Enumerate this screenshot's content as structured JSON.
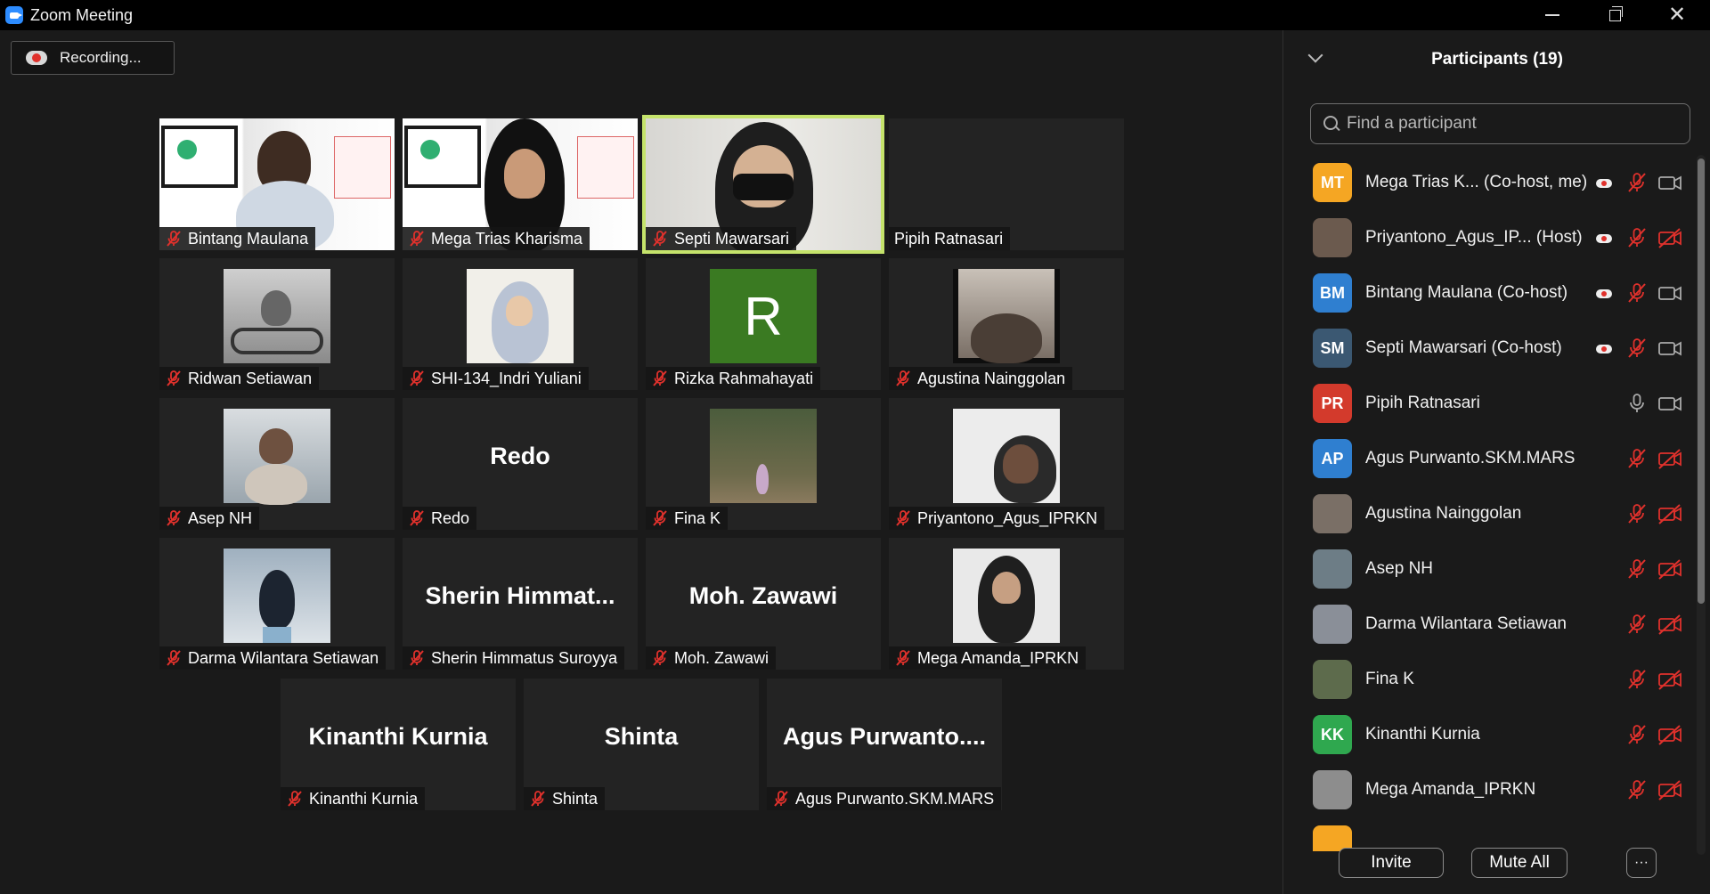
{
  "window": {
    "title": "Zoom Meeting"
  },
  "recording": {
    "label": "Recording..."
  },
  "tiles": [
    {
      "name": "Bintang Maulana",
      "kind": "video",
      "active": false
    },
    {
      "name": "Mega Trias Kharisma",
      "kind": "video",
      "active": false
    },
    {
      "name": "Septi Mawarsari",
      "kind": "video",
      "active": true
    },
    {
      "name": "Pipih Ratnasari",
      "kind": "blank",
      "active": false
    },
    {
      "name": "Ridwan Setiawan",
      "kind": "photo",
      "active": false
    },
    {
      "name": "SHI-134_Indri Yuliani",
      "kind": "photo",
      "active": false
    },
    {
      "name": "Rizka Rahmahayati",
      "kind": "initial",
      "initial": "R",
      "active": false
    },
    {
      "name": "Agustina Nainggolan",
      "kind": "photo",
      "active": false
    },
    {
      "name": "Asep NH",
      "kind": "photo",
      "active": false
    },
    {
      "name": "Redo",
      "kind": "text",
      "display": "Redo",
      "active": false
    },
    {
      "name": "Fina K",
      "kind": "photo",
      "active": false
    },
    {
      "name": "Priyantono_Agus_IPRKN",
      "kind": "photo",
      "active": false
    },
    {
      "name": "Darma Wilantara Setiawan",
      "kind": "photo",
      "active": false
    },
    {
      "name": "Sherin Himmatus Suroyya",
      "kind": "text",
      "display": "Sherin  Himmat...",
      "active": false
    },
    {
      "name": "Moh. Zawawi",
      "kind": "text",
      "display": "Moh. Zawawi",
      "active": false
    },
    {
      "name": "Mega Amanda_IPRKN",
      "kind": "photo",
      "active": false
    },
    {
      "name": "Kinanthi Kurnia",
      "kind": "text",
      "display": "Kinanthi Kurnia",
      "active": false
    },
    {
      "name": "Shinta",
      "kind": "text",
      "display": "Shinta",
      "active": false
    },
    {
      "name": "Agus Purwanto.SKM.MARS",
      "kind": "text",
      "display": "Agus  Purwanto....",
      "active": false
    }
  ],
  "panel": {
    "title": "Participants (19)",
    "search_placeholder": "Find a participant",
    "participants": [
      {
        "initials": "MT",
        "color": "#f5a623",
        "name": "Mega Trias K...  (Co-host, me)",
        "recording": true,
        "mic": "muted",
        "cam": "on"
      },
      {
        "initials": "",
        "color": "#6b5a4e",
        "name": "Priyantono_Agus_IP...  (Host)",
        "recording": true,
        "mic": "muted",
        "cam": "off"
      },
      {
        "initials": "BM",
        "color": "#2f7fd0",
        "name": "Bintang Maulana (Co-host)",
        "recording": true,
        "mic": "muted",
        "cam": "on"
      },
      {
        "initials": "SM",
        "color": "#3b5872",
        "name": "Septi Mawarsari (Co-host)",
        "recording": true,
        "mic": "muted",
        "cam": "on"
      },
      {
        "initials": "PR",
        "color": "#d33a2c",
        "name": "Pipih Ratnasari",
        "recording": false,
        "mic": "on",
        "cam": "on"
      },
      {
        "initials": "AP",
        "color": "#2f7fd0",
        "name": "Agus Purwanto.SKM.MARS",
        "recording": false,
        "mic": "muted",
        "cam": "off"
      },
      {
        "initials": "",
        "color": "#7a6f66",
        "name": "Agustina Nainggolan",
        "recording": false,
        "mic": "muted",
        "cam": "off"
      },
      {
        "initials": "",
        "color": "#6d7d86",
        "name": "Asep NH",
        "recording": false,
        "mic": "muted",
        "cam": "off"
      },
      {
        "initials": "",
        "color": "#8a8f98",
        "name": "Darma Wilantara Setiawan",
        "recording": false,
        "mic": "muted",
        "cam": "off"
      },
      {
        "initials": "",
        "color": "#5d6b4c",
        "name": "Fina K",
        "recording": false,
        "mic": "muted",
        "cam": "off"
      },
      {
        "initials": "KK",
        "color": "#2fa84f",
        "name": "Kinanthi Kurnia",
        "recording": false,
        "mic": "muted",
        "cam": "off"
      },
      {
        "initials": "",
        "color": "#8d8d8d",
        "name": "Mega Amanda_IPRKN",
        "recording": false,
        "mic": "muted",
        "cam": "off"
      },
      {
        "initials": "",
        "color": "#f5a623",
        "name": "",
        "recording": false,
        "mic": "none",
        "cam": "none"
      }
    ],
    "invite_label": "Invite",
    "mute_all_label": "Mute All",
    "more_label": "···"
  },
  "colors": {
    "muted_mic": "#e0312c",
    "active_speaker": "#c5e36b",
    "rizka_bg": "#3a7a22"
  }
}
